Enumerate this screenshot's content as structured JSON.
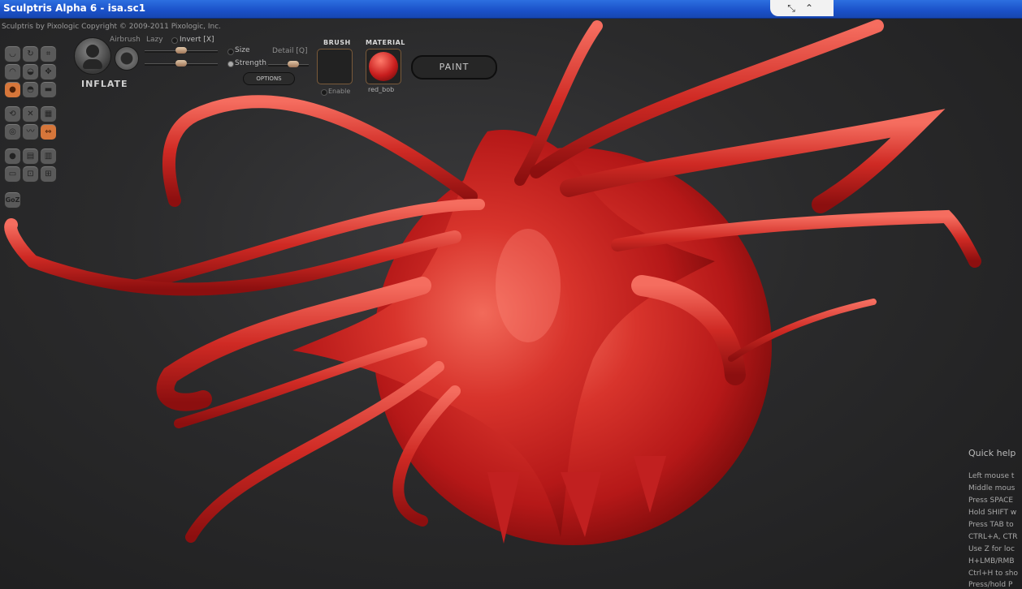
{
  "window": {
    "title": "Sculptris Alpha 6 - isa.sc1"
  },
  "header": {
    "copyright": "Sculptris by Pixologic   Copyright © 2009-2011 Pixologic, Inc."
  },
  "toolbar": {
    "tool_name": "INFLATE",
    "airbrush": "Airbrush",
    "lazy": "Lazy",
    "invert": "Invert [X]",
    "size": "Size",
    "detail": "Detail [Q]",
    "strength": "Strength",
    "options": "OPTIONS",
    "brush_title": "BRUSH",
    "enable": "Enable",
    "material_title": "MATERIAL",
    "material_name": "red_bob",
    "paint": "PAINT",
    "goz": "GoZ"
  },
  "quick_help": {
    "title": "Quick help",
    "lines": [
      "Left mouse t",
      "Middle mous",
      "Press SPACE",
      "Hold SHIFT w",
      "Press TAB to",
      "CTRL+A, CTR",
      "Use Z for loc",
      "H+LMB/RMB",
      "Ctrl+H to sho",
      "Press/hold P"
    ]
  },
  "colors": {
    "accent": "#d6763a",
    "title_bar": "#1a50c8",
    "model": "#c81e1e"
  }
}
